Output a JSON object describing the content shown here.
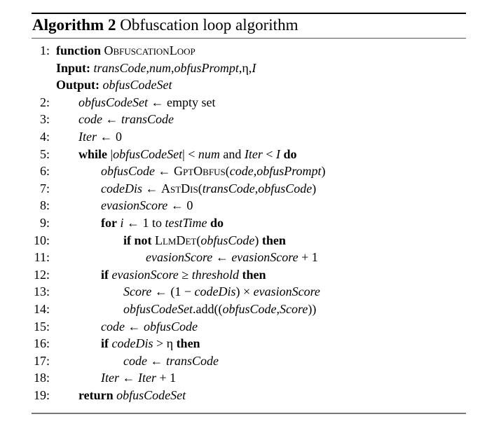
{
  "caption": {
    "label": "Algorithm 2",
    "title": "Obfuscation loop algorithm"
  },
  "lines": [
    {
      "num": "1:",
      "indent": 0,
      "html": "<span class='kw'>function</span> <span class='sc'>ObfuscationLoop</span>"
    },
    {
      "num": "",
      "indent": 0,
      "html": "<span class='kw'>Input:</span> <span class='v'>transCode</span>,<span class='v'>num</span>,<span class='v'>obfusPrompt</span>,η,<span class='v'>I</span>"
    },
    {
      "num": "",
      "indent": 0,
      "html": "<span class='kw'>Output:</span> <span class='v'>obfusCodeSet</span>"
    },
    {
      "num": "2:",
      "indent": 1,
      "html": "<span class='v'>obfusCodeSet</span> ← empty set"
    },
    {
      "num": "3:",
      "indent": 1,
      "html": "<span class='v'>code</span> ← <span class='v'>transCode</span>"
    },
    {
      "num": "4:",
      "indent": 1,
      "html": "<span class='v'>Iter</span> ← 0"
    },
    {
      "num": "5:",
      "indent": 1,
      "html": "<span class='kw'>while</span> |<span class='v'>obfusCodeSet</span>| &lt; <span class='v'>num</span> and <span class='v'>Iter</span> &lt; <span class='v'>I</span> <span class='kw'>do</span>"
    },
    {
      "num": "6:",
      "indent": 2,
      "html": "<span class='v'>obfusCode</span> ← <span class='sc'>GptObfus</span>(<span class='v'>code</span>,<span class='v'>obfusPrompt</span>)"
    },
    {
      "num": "7:",
      "indent": 2,
      "html": "<span class='v'>codeDis</span> ← <span class='sc'>AstDis</span>(<span class='v'>transCode</span>,<span class='v'>obfusCode</span>)"
    },
    {
      "num": "8:",
      "indent": 2,
      "html": "<span class='v'>evasionScore</span> ← 0"
    },
    {
      "num": "9:",
      "indent": 2,
      "html": "<span class='kw'>for</span> <span class='v'>i</span> ← 1 to <span class='v'>testTime</span> <span class='kw'>do</span>"
    },
    {
      "num": "10:",
      "indent": 3,
      "html": "<span class='kw'>if not</span> <span class='sc'>LlmDet</span>(<span class='v'>obfusCode</span>) <span class='kw'>then</span>"
    },
    {
      "num": "11:",
      "indent": 4,
      "html": "<span class='v'>evasionScore</span> ← <span class='v'>evasionScore</span> + 1"
    },
    {
      "num": "12:",
      "indent": 2,
      "html": "<span class='kw'>if</span> <span class='v'>evasionScore</span> ≥ <span class='v'>threshold</span> <span class='kw'>then</span>"
    },
    {
      "num": "13:",
      "indent": 3,
      "html": "<span class='v'>Score</span> ← (1 − <span class='v'>codeDis</span>) × <span class='v'>evasionScore</span>"
    },
    {
      "num": "14:",
      "indent": 3,
      "html": "<span class='v'>obfusCodeSet</span>.add((<span class='v'>obfusCode</span>,<span class='v'>Score</span>))"
    },
    {
      "num": "15:",
      "indent": 2,
      "html": "<span class='v'>code</span> ← <span class='v'>obfusCode</span>"
    },
    {
      "num": "16:",
      "indent": 2,
      "html": "<span class='kw'>if</span> <span class='v'>codeDis</span> &gt; η <span class='kw'>then</span>"
    },
    {
      "num": "17:",
      "indent": 3,
      "html": "<span class='v'>code</span> ← <span class='v'>transCode</span>"
    },
    {
      "num": "18:",
      "indent": 2,
      "html": "<span class='v'>Iter</span> ← <span class='v'>Iter</span> + 1"
    },
    {
      "num": "19:",
      "indent": 1,
      "html": "<span class='kw'>return</span> <span class='v'>obfusCodeSet</span>"
    }
  ]
}
